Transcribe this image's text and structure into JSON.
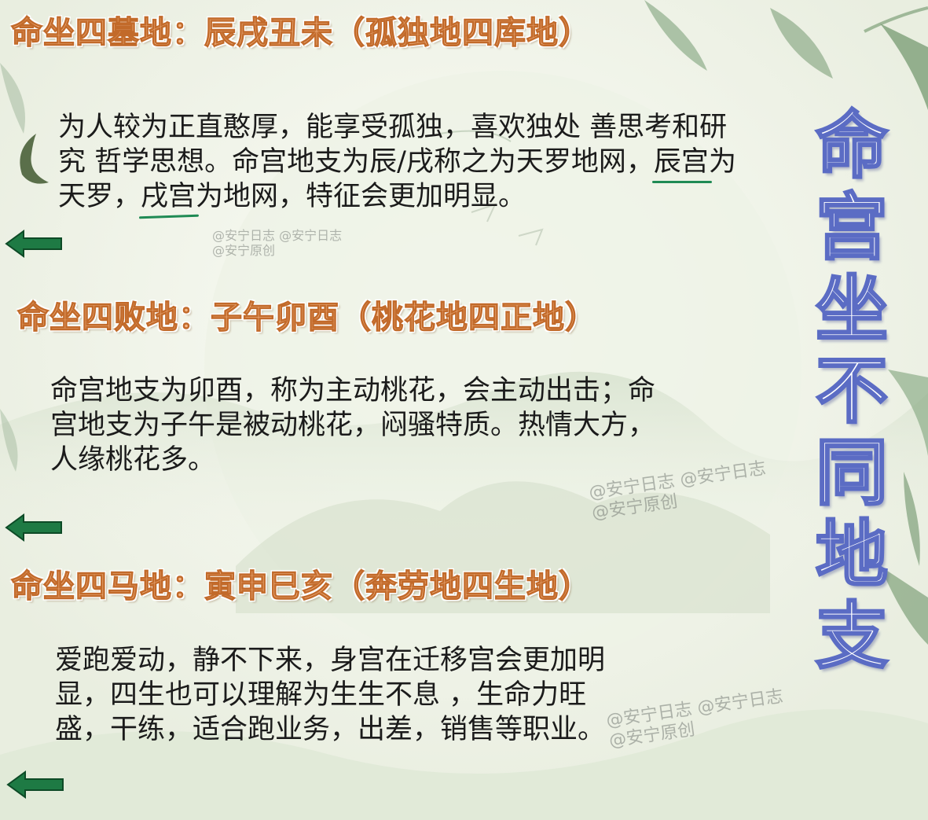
{
  "sections": [
    {
      "heading": "命坐四墓地：辰戌丑未（孤独地四库地）",
      "body_plain_1": "为人较为正直憨厚，能享受孤独，喜欢独处 善思考和研究 哲学思想。命宫地支为辰/戌称之为天罗地网，",
      "body_mark_1": "辰宫",
      "body_plain_2": "为天罗，",
      "body_mark_2": "戌宫",
      "body_plain_3": "为地网，特征会更加明显。"
    },
    {
      "heading": "命坐四败地：子午卯酉（桃花地四正地）",
      "body": "命宫地支为卯酉，称为主动桃花，会主动出击；命宫地支为子午是被动桃花，闷骚特质。热情大方，人缘桃花多。"
    },
    {
      "heading": "命坐四马地：寅申巳亥（奔劳地四生地）",
      "body": "爱跑爱动，静不下来，身宫在迁移宫会更加明显，四生也可以理解为生生不息 ，生命力旺盛，干练，适合跑业务，出差，销售等职业。"
    }
  ],
  "side_title": [
    "命",
    "宫",
    "坐",
    "不",
    "同",
    "地",
    "支"
  ],
  "watermarks": [
    {
      "line1": "@安宁日志 @安宁日志",
      "line2": "@安宁原创"
    },
    {
      "line1": "@安宁日志 @安宁日志",
      "line2": "@安宁原创"
    },
    {
      "line1": "@安宁日志 @安宁日志",
      "line2": "@安宁原创"
    }
  ],
  "icons": {
    "arrow": "left-arrow-icon",
    "leaf": "leaf-icon",
    "moon": "crescent-moon-icon"
  },
  "colors": {
    "heading_fill": "#f5b98b",
    "heading_stroke": "#c26a2a",
    "side_title_stroke": "#5b6cc4",
    "arrow": "#1e7a44",
    "underline": "#1f8a54"
  }
}
